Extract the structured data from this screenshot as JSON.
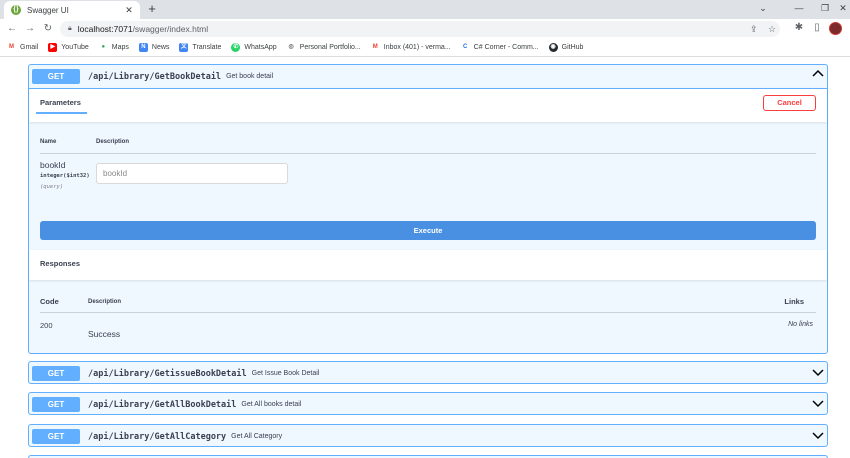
{
  "browser": {
    "tab_title": "Swagger UI",
    "url_host": "localhost:7071",
    "url_path": "/swagger/index.html",
    "bookmarks": [
      {
        "label": "Gmail",
        "color": "#ea4335",
        "glyph": "M"
      },
      {
        "label": "YouTube",
        "color": "#ff0000",
        "glyph": "▶"
      },
      {
        "label": "Maps",
        "color": "#34a853",
        "glyph": "●"
      },
      {
        "label": "News",
        "color": "#4285f4",
        "glyph": "N"
      },
      {
        "label": "Translate",
        "color": "#4285f4",
        "glyph": "文"
      },
      {
        "label": "WhatsApp",
        "color": "#25d366",
        "glyph": "✆"
      },
      {
        "label": "Personal Portfolio...",
        "color": "#5f6368",
        "glyph": "◎"
      },
      {
        "label": "Inbox (401) - verma...",
        "color": "#ea4335",
        "glyph": "M"
      },
      {
        "label": "C# Corner - Comm...",
        "color": "#1a73e8",
        "glyph": "C"
      },
      {
        "label": "GitHub",
        "color": "#24292e",
        "glyph": "◉"
      }
    ]
  },
  "endpoint_expanded": {
    "method": "GET",
    "path": "/api/Library/GetBookDetail",
    "summary": "Get book detail",
    "parameters_tab": "Parameters",
    "cancel_label": "Cancel",
    "col_name": "Name",
    "col_description": "Description",
    "param": {
      "name": "bookId",
      "type": "integer($int32)",
      "location": "(query)",
      "placeholder": "bookId"
    },
    "execute_label": "Execute",
    "responses_title": "Responses",
    "resp_col_code": "Code",
    "resp_col_description": "Description",
    "resp_col_links": "Links",
    "response": {
      "code": "200",
      "description": "Success",
      "links": "No links"
    }
  },
  "endpoints_collapsed": [
    {
      "method": "GET",
      "path": "/api/Library/GetissueBookDetail",
      "summary": "Get Issue Book Detail"
    },
    {
      "method": "GET",
      "path": "/api/Library/GetAllBookDetail",
      "summary": "Get All books detail"
    },
    {
      "method": "GET",
      "path": "/api/Library/GetAllCategory",
      "summary": "Get All Category"
    }
  ],
  "colors": {
    "get_method": "#61affe",
    "execute": "#4990e2",
    "cancel": "#f93e3e"
  }
}
